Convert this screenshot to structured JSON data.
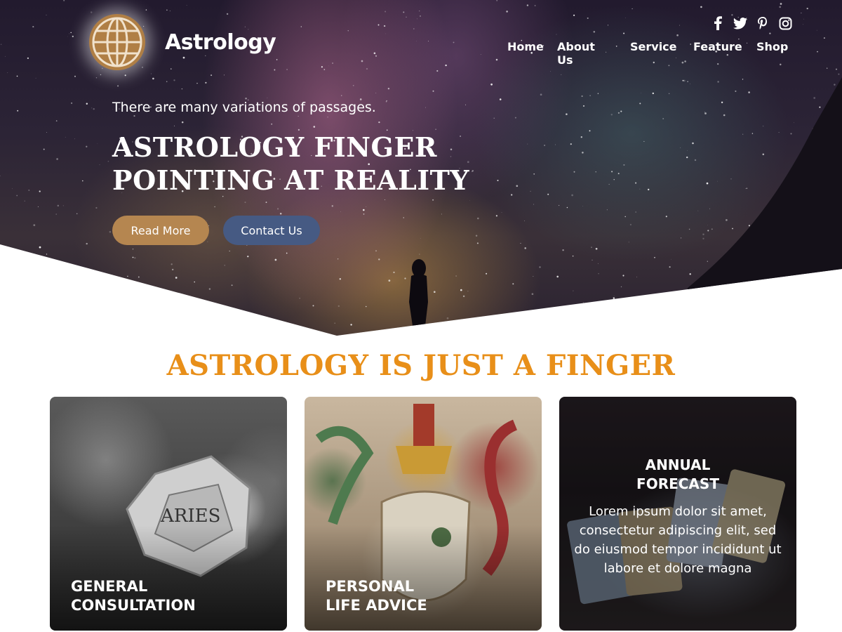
{
  "header": {
    "brand": "Astrology",
    "logo_icon": "globe-icon",
    "social": [
      "facebook-icon",
      "twitter-icon",
      "pinterest-icon",
      "instagram-icon"
    ],
    "nav": [
      "Home",
      "About Us",
      "Service",
      "Feature",
      "Shop"
    ]
  },
  "hero": {
    "tagline": "There are many variations of passages.",
    "headline_line1": "Astrology Finger",
    "headline_line2": "Pointing at Reality",
    "read_more": "Read More",
    "contact_us": "Contact Us"
  },
  "section": {
    "title": "Astrology is just a finger",
    "cards": [
      {
        "title_line1": "General",
        "title_line2": "Consultation"
      },
      {
        "title_line1": "Personal",
        "title_line2": "Life Advice"
      },
      {
        "title_line1": "Annual",
        "title_line2": "Forecast",
        "body": "Lorem ipsum dolor sit amet, consectetur adipiscing elit, sed do eiusmod tempor incididunt ut labore et dolore magna"
      }
    ]
  },
  "colors": {
    "accent": "#e88f19",
    "read_more_bg": "#b58650",
    "contact_bg": "#465a83",
    "logo_bg": "#b07f45"
  }
}
